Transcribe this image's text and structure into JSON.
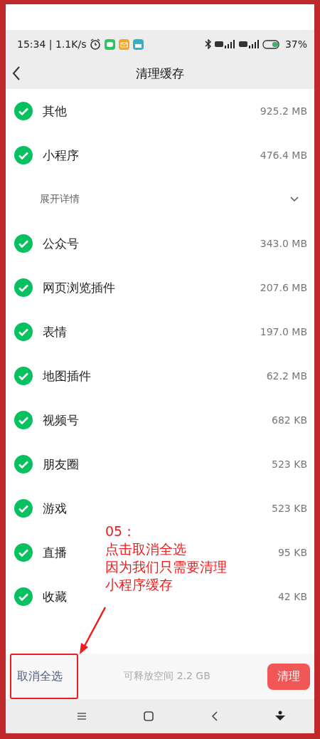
{
  "status_bar": {
    "time_speed": "15:34 | 1.1K/s",
    "battery": "37%"
  },
  "header": {
    "title": "清理缓存"
  },
  "items": [
    {
      "kind": "item",
      "label": "其他",
      "size": "925.2 MB",
      "checked": true
    },
    {
      "kind": "item",
      "label": "小程序",
      "size": "476.4 MB",
      "checked": true
    },
    {
      "kind": "expand",
      "label": "展开详情",
      "expanded": false
    },
    {
      "kind": "item",
      "label": "公众号",
      "size": "343.0 MB",
      "checked": true
    },
    {
      "kind": "item",
      "label": "网页浏览插件",
      "size": "207.6 MB",
      "checked": true
    },
    {
      "kind": "item",
      "label": "表情",
      "size": "197.0 MB",
      "checked": true
    },
    {
      "kind": "item",
      "label": "地图插件",
      "size": "62.2 MB",
      "checked": true
    },
    {
      "kind": "item",
      "label": "视频号",
      "size": "682 KB",
      "checked": true
    },
    {
      "kind": "item",
      "label": "朋友圈",
      "size": "523 KB",
      "checked": true
    },
    {
      "kind": "item",
      "label": "游戏",
      "size": "523 KB",
      "checked": true
    },
    {
      "kind": "item",
      "label": "直播",
      "size": "95 KB",
      "checked": true
    },
    {
      "kind": "item",
      "label": "收藏",
      "size": "42 KB",
      "checked": true
    }
  ],
  "bottom_bar": {
    "deselect_all": "取消全选",
    "free_space": "可释放空间 2.2 GB",
    "clean_button": "清理"
  },
  "annotation": {
    "lines": [
      "05：",
      "点击取消全选",
      "因为我们只需要清理",
      "小程序缓存"
    ]
  }
}
